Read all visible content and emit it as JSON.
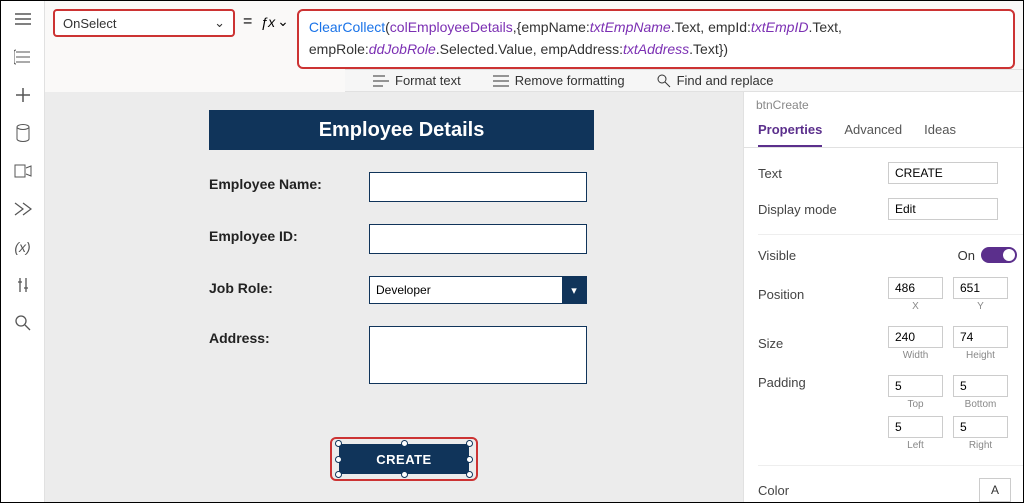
{
  "propertyDropdown": {
    "value": "OnSelect"
  },
  "formula": {
    "fn": "ClearCollect",
    "collection": "colEmployeeDetails",
    "parts": {
      "empNameKey": "empName:",
      "empNameRef": "txtEmpName",
      "empNameProp": ".Text, ",
      "empIdKey": "empId:",
      "empIdRef": "txtEmpID",
      "empIdProp": ".Text,",
      "empRoleKey": "empRole:",
      "empRoleRef": "ddJobRole",
      "empRoleProp": ".Selected.Value, ",
      "empAddrKey": "empAddress:",
      "empAddrRef": "txtAddress",
      "empAddrProp": ".Text})"
    },
    "openParen": "(",
    "comma1": ",{"
  },
  "formatBar": {
    "format": "Format text",
    "remove": "Remove formatting",
    "find": "Find and replace"
  },
  "canvas": {
    "title": "Employee Details",
    "labels": {
      "name": "Employee Name:",
      "id": "Employee ID:",
      "role": "Job Role:",
      "address": "Address:"
    },
    "roleValue": "Developer",
    "createLabel": "CREATE"
  },
  "props": {
    "objectName": "btnCreate",
    "tabs": {
      "properties": "Properties",
      "advanced": "Advanced",
      "ideas": "Ideas"
    },
    "text": {
      "label": "Text",
      "value": "CREATE"
    },
    "displayMode": {
      "label": "Display mode",
      "value": "Edit"
    },
    "visible": {
      "label": "Visible",
      "value": "On"
    },
    "position": {
      "label": "Position",
      "x": "486",
      "y": "651",
      "xlabel": "X",
      "ylabel": "Y"
    },
    "size": {
      "label": "Size",
      "w": "240",
      "h": "74",
      "wlabel": "Width",
      "hlabel": "Height"
    },
    "padding": {
      "label": "Padding",
      "top": "5",
      "bottom": "5",
      "left": "5",
      "right": "5",
      "topL": "Top",
      "bottomL": "Bottom",
      "leftL": "Left",
      "rightL": "Right"
    },
    "color": {
      "label": "Color",
      "glyph": "A"
    }
  }
}
